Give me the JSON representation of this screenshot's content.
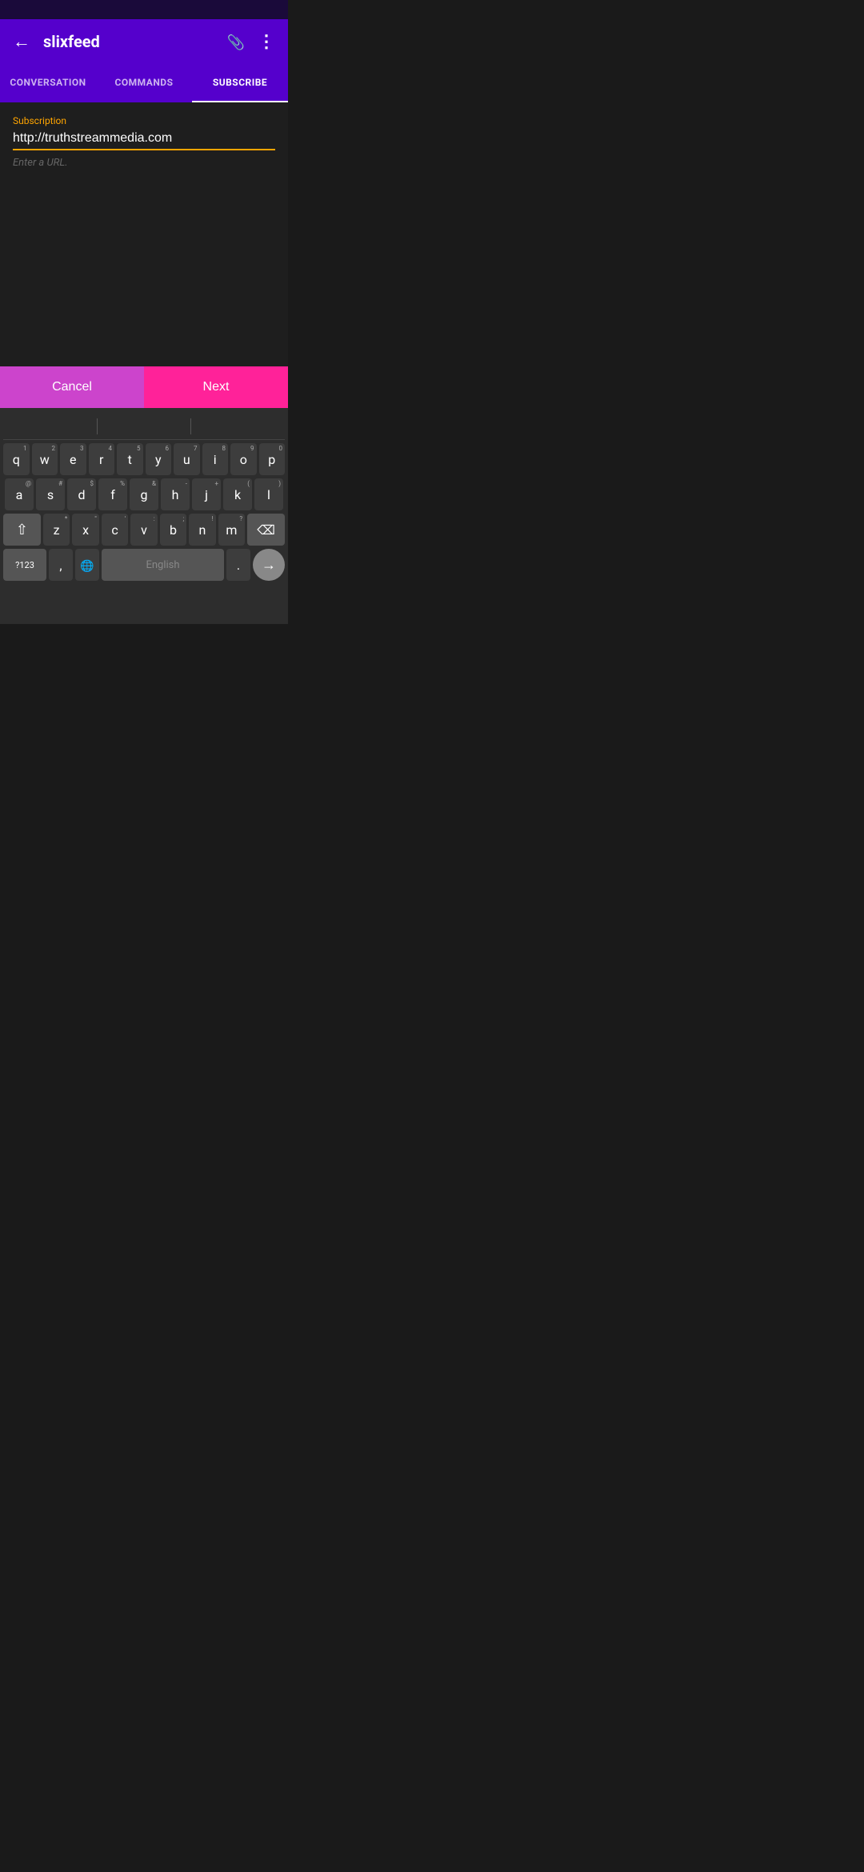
{
  "statusBar": {},
  "appBar": {
    "title": "slixfeed",
    "backIcon": "back-icon",
    "attachIcon": "attach-icon",
    "moreIcon": "more-icon"
  },
  "tabs": [
    {
      "id": "conversation",
      "label": "CONVERSATION",
      "active": false
    },
    {
      "id": "commands",
      "label": "COMMANDS",
      "active": false
    },
    {
      "id": "subscribe",
      "label": "SUBSCRIBE",
      "active": true
    }
  ],
  "subscribeForm": {
    "label": "Subscription",
    "urlValue": "http://truthstreammedia.com",
    "placeholder": "Enter a URL."
  },
  "buttons": {
    "cancel": "Cancel",
    "next": "Next"
  },
  "keyboard": {
    "language": "English",
    "rows": [
      [
        "q",
        "w",
        "e",
        "r",
        "t",
        "y",
        "u",
        "i",
        "o",
        "p"
      ],
      [
        "a",
        "s",
        "d",
        "f",
        "g",
        "h",
        "j",
        "k",
        "l"
      ],
      [
        "z",
        "x",
        "c",
        "v",
        "b",
        "n",
        "m"
      ]
    ],
    "subs": {
      "q": "1",
      "w": "2",
      "e": "3",
      "r": "4",
      "t": "5",
      "y": "6",
      "u": "7",
      "i": "8",
      "o": "9",
      "p": "0",
      "a": "@",
      "s": "#",
      "d": "$",
      "f": "%",
      "g": "&",
      "h": "-",
      "j": "+",
      "k": "(",
      "l": ")",
      "z": "*",
      "x": "\"",
      "c": "'",
      "v": ":",
      "b": ";",
      "n": "!",
      "m": "?"
    },
    "specialKeys": {
      "123": "?123",
      "comma": ",",
      "period": "."
    }
  }
}
